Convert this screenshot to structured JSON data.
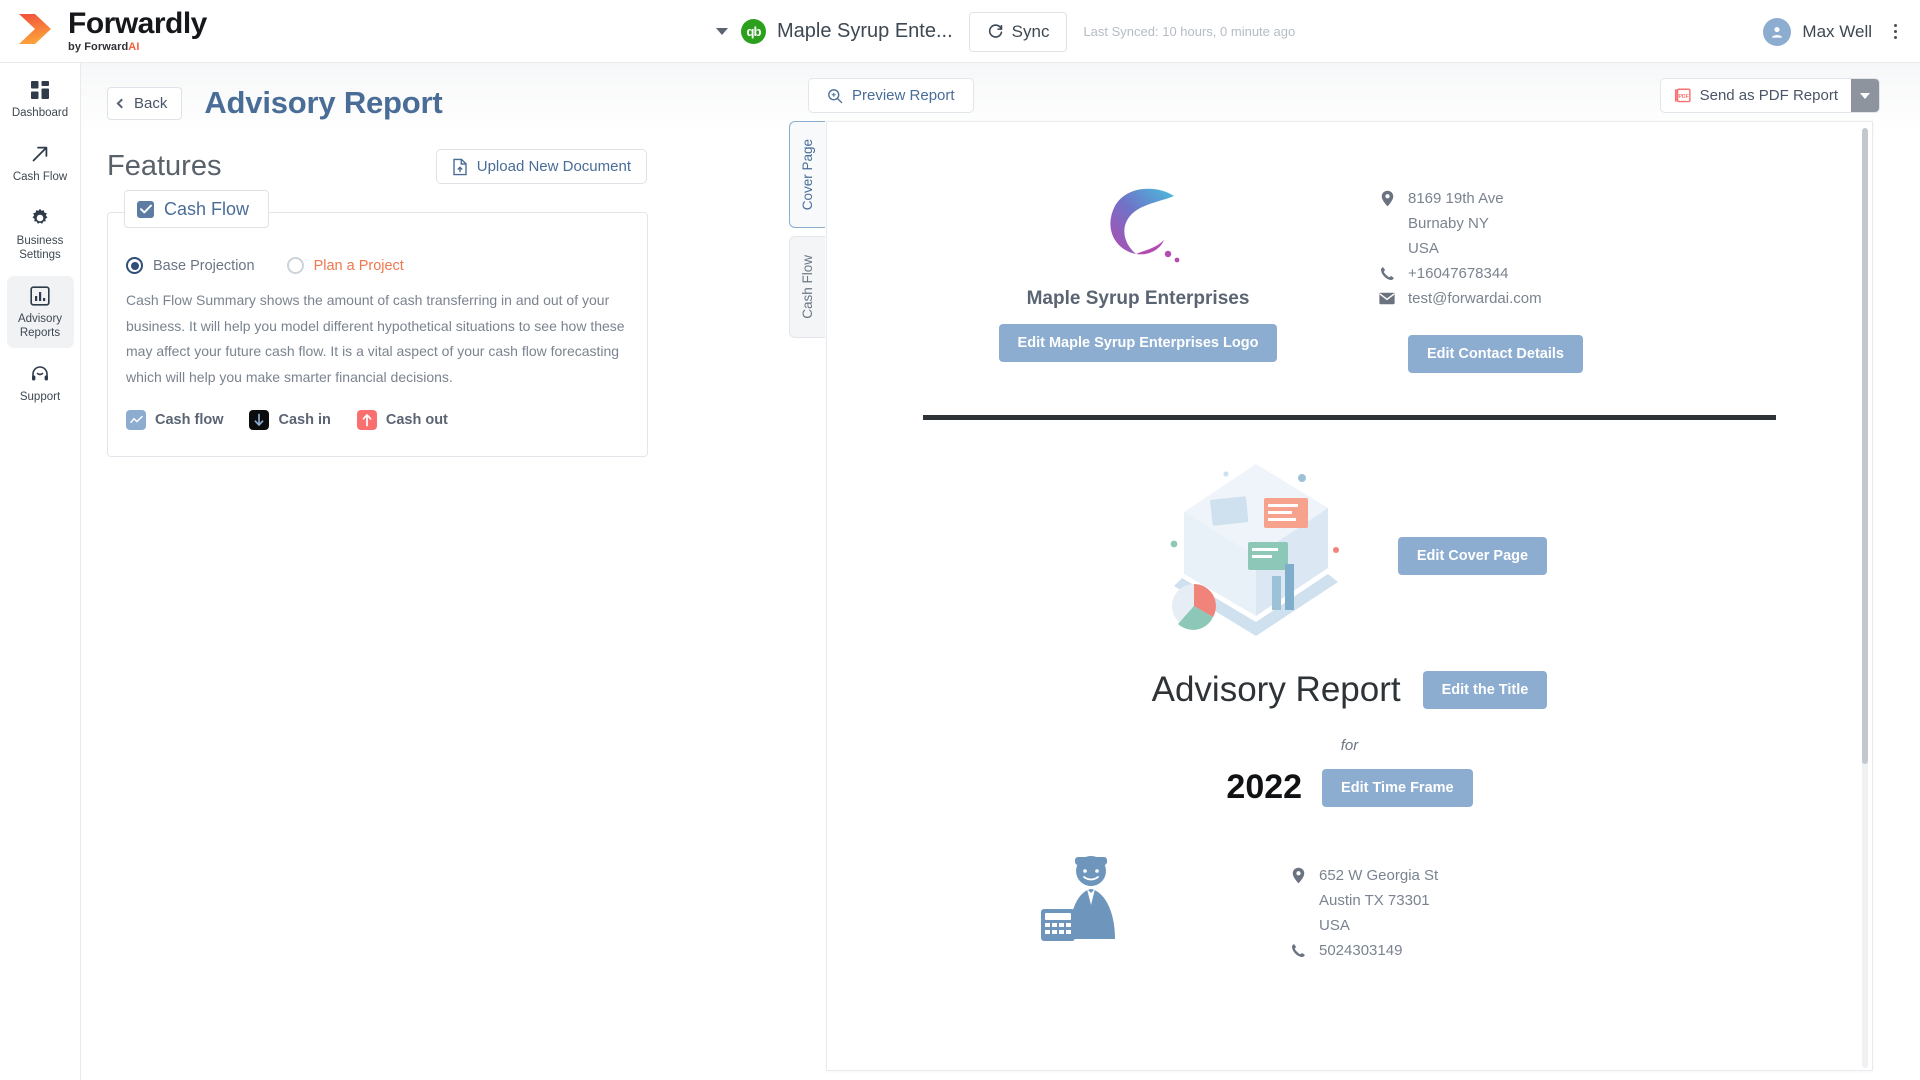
{
  "brand": {
    "name": "Forwardly",
    "sub_prefix": "by Forward",
    "sub_accent": "AI",
    "logo_icon": "chevron-forward-logo"
  },
  "topbar": {
    "company_switch_icon": "chevron-down-icon",
    "accounting_badge": "qb",
    "company_name": "Maple Syrup Ente...",
    "sync_label": "Sync",
    "sync_icon": "refresh-icon",
    "last_synced": "Last Synced: 10 hours, 0 minute ago",
    "user_name": "Max Well",
    "avatar_icon": "user-avatar-icon",
    "overflow_icon": "kebab-menu-icon"
  },
  "sidebar": {
    "items": [
      {
        "label": "Dashboard",
        "icon": "grid-dashboard-icon",
        "active": false
      },
      {
        "label": "Cash Flow",
        "icon": "arrow-up-right-icon",
        "active": false
      },
      {
        "label": "Business Settings",
        "icon": "gear-icon",
        "active": false
      },
      {
        "label": "Advisory Reports",
        "icon": "bar-chart-icon",
        "active": true
      },
      {
        "label": "Support",
        "icon": "headset-icon",
        "active": false
      }
    ]
  },
  "page": {
    "back_label": "Back",
    "back_icon": "chevron-left-icon",
    "title": "Advisory Report"
  },
  "features": {
    "heading": "Features",
    "upload_label": "Upload New Document",
    "upload_icon": "document-upload-icon",
    "card": {
      "legend_label": "Cash Flow",
      "checkbox_icon": "checkmark-icon",
      "checked": true,
      "radios": [
        {
          "label": "Base Projection",
          "selected": true
        },
        {
          "label": "Plan a Project",
          "selected": false
        }
      ],
      "description": "Cash Flow Summary shows the amount of cash transferring in and out of your business. It will help you model different hypothetical situations to see how these may affect your future cash flow. It is a vital aspect of your cash flow forecasting which will help you make smarter financial decisions.",
      "tags": [
        {
          "label": "Cash flow",
          "icon": "line-chart-icon",
          "color": "#8cadd0"
        },
        {
          "label": "Cash in",
          "icon": "arrow-down-icon",
          "color": "#0b0c0d"
        },
        {
          "label": "Cash out",
          "icon": "arrow-up-icon",
          "color": "#fa7070"
        }
      ]
    }
  },
  "preview": {
    "preview_button": "Preview Report",
    "preview_icon": "magnifier-icon",
    "send_pdf_label": "Send as PDF Report",
    "send_pdf_icon": "pdf-file-icon",
    "send_pdf_caret_icon": "chevron-down-icon",
    "tabs": [
      {
        "label": "Cover Page",
        "active": true
      },
      {
        "label": "Cash Flow",
        "active": false
      }
    ]
  },
  "document": {
    "company_logo_icon": "swirl-logo-icon",
    "company_title": "Maple Syrup Enterprises",
    "edit_logo_label": "Edit Maple Syrup Enterprises Logo",
    "contact": {
      "address_icon": "location-pin-icon",
      "address_line1": "8169 19th Ave",
      "address_line2": "Burnaby NY",
      "address_line3": "USA",
      "phone_icon": "phone-icon",
      "phone": "+16047678344",
      "email_icon": "envelope-icon",
      "email": "test@forwardai.com",
      "edit_label": "Edit Contact Details"
    },
    "cover_illustration_icon": "laptop-analytics-illustration",
    "edit_cover_page_label": "Edit Cover Page",
    "report_title": "Advisory Report",
    "edit_title_label": "Edit the Title",
    "for_word": "for",
    "year": "2022",
    "edit_time_frame_label": "Edit Time Frame",
    "accountant_icon": "accountant-illustration",
    "accountant_contact": {
      "address_icon": "location-pin-icon",
      "address_line1": "652 W Georgia St",
      "address_line2": "Austin TX  73301",
      "address_line3": "USA",
      "phone_icon": "phone-icon",
      "phone": "5024303149"
    }
  },
  "colors": {
    "accent_blue": "#4a6d97",
    "button_blue": "#8cadd0",
    "accent_orange": "#f0784d",
    "brand_orange": "#f4623a",
    "qb_green": "#2ca01c",
    "cash_out_red": "#fa7070"
  }
}
